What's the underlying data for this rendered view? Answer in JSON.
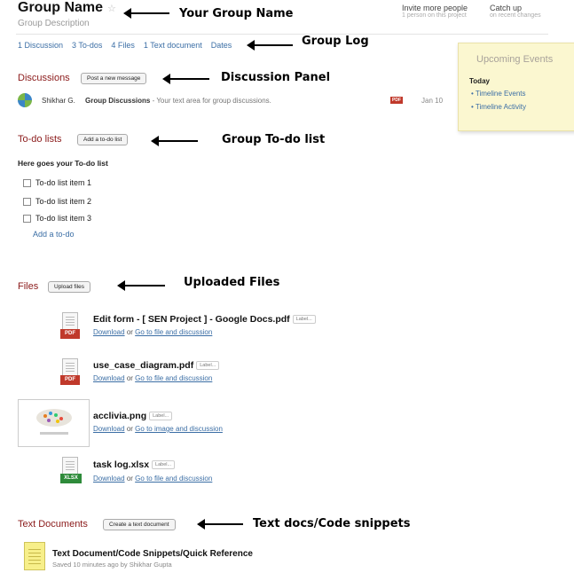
{
  "header": {
    "group_name": "Group Name",
    "group_description": "Group Description",
    "invite_label": "Invite more people",
    "invite_sub": "1 person on this project",
    "catchup_label": "Catch up",
    "catchup_sub": "on recent changes"
  },
  "tabs": [
    "1 Discussion",
    "3 To-dos",
    "4 Files",
    "1 Text document",
    "Dates"
  ],
  "annotations": {
    "group_name": "Your Group Name",
    "group_log": "Group Log",
    "discussion": "Discussion Panel",
    "todo": "Group To-do list",
    "files": "Uploaded Files",
    "text_docs": "Text docs/Code snippets"
  },
  "upcoming": {
    "title": "Upcoming Events",
    "today": "Today",
    "items": [
      "Timeline Events",
      "Timeline Activity"
    ]
  },
  "discussions": {
    "title": "Discussions",
    "button": "Post a new message",
    "rows": [
      {
        "author": "Shikhar G.",
        "title": "Group Discussions",
        "excerpt": " - Your text area for group discussions.",
        "attachment": "PDF",
        "date": "Jan 10"
      }
    ]
  },
  "todos": {
    "title": "To-do lists",
    "button": "Add a to-do list",
    "list_title": "Here goes your To-do list",
    "items": [
      "To-do list item 1",
      "To-do list item 2",
      "To-do list item 3"
    ],
    "add_link": "Add a to-do"
  },
  "files": {
    "title": "Files",
    "button": "Upload files",
    "label_tag": "Label...",
    "download": "Download",
    "or": "or",
    "items": [
      {
        "name": "Edit form - [ SEN Project ] - Google Docs.pdf",
        "badge": "PDF",
        "goto": "Go to file and discussion"
      },
      {
        "name": "use_case_diagram.pdf",
        "badge": "PDF",
        "goto": "Go to file and discussion"
      },
      {
        "name": "acclivia.png",
        "badge": "",
        "goto": "Go to image and discussion"
      },
      {
        "name": "task log.xlsx",
        "badge": "XLSX",
        "goto": "Go to file and discussion"
      }
    ]
  },
  "text_documents": {
    "title": "Text Documents",
    "button": "Create a text document",
    "items": [
      {
        "title": "Text Document/Code Snippets/Quick Reference",
        "meta": "Saved 10 minutes ago by Shikhar Gupta"
      }
    ]
  }
}
